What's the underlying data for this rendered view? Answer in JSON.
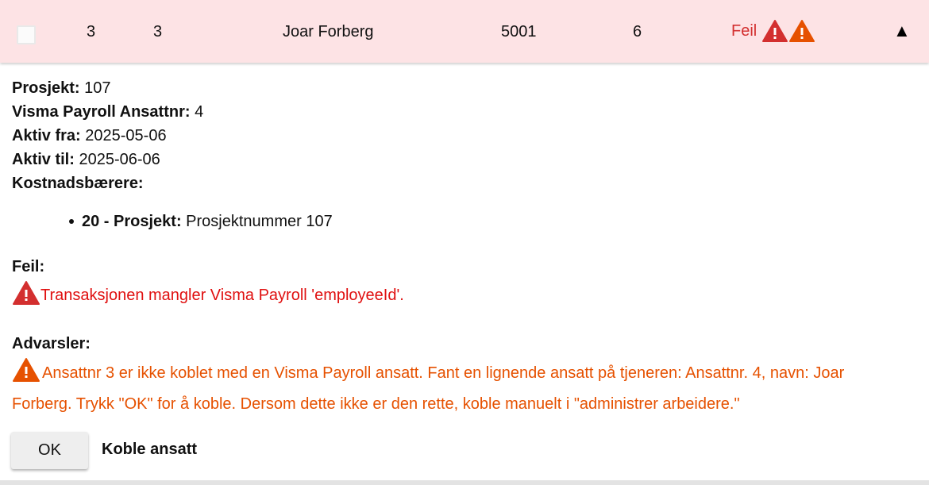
{
  "row": {
    "col_a": "3",
    "col_b": "3",
    "name": "Joar Forberg",
    "number": "5001",
    "count": "6",
    "status": "Feil",
    "expand_glyph": "▲",
    "icons": [
      "error-triangle-icon",
      "warning-triangle-icon"
    ]
  },
  "details": {
    "project_label": "Prosjekt:",
    "project_value": " 107",
    "payroll_label": "Visma Payroll Ansattnr:",
    "payroll_value": " 4",
    "from_label": "Aktiv fra:",
    "from_value": " 2025-05-06",
    "to_label": "Aktiv til:",
    "to_value": " 2025-06-06",
    "cost_label": "Kostnadsbærere:",
    "cost_items": [
      {
        "label": "20 - Prosjekt:",
        "value": " Prosjektnummer 107"
      }
    ]
  },
  "errors": {
    "heading": "Feil:",
    "message": "Transaksjonen mangler Visma Payroll 'employeeId'."
  },
  "warnings": {
    "heading": "Advarsler:",
    "message": "Ansattnr 3 er ikke koblet med en Visma Payroll ansatt. Fant en lignende ansatt på tjeneren: Ansattnr. 4, navn: Joar Forberg. Trykk \"OK\" for å koble. Dersom dette ikke er den rette, koble manuelt i \"administrer arbeidere.\""
  },
  "actions": {
    "ok_label": "OK",
    "connect_label": "Koble ansatt"
  },
  "colors": {
    "row_bg": "#fde3e5",
    "error": "#e01010",
    "error_icon": "#d32f2f",
    "warning": "#e65100"
  }
}
